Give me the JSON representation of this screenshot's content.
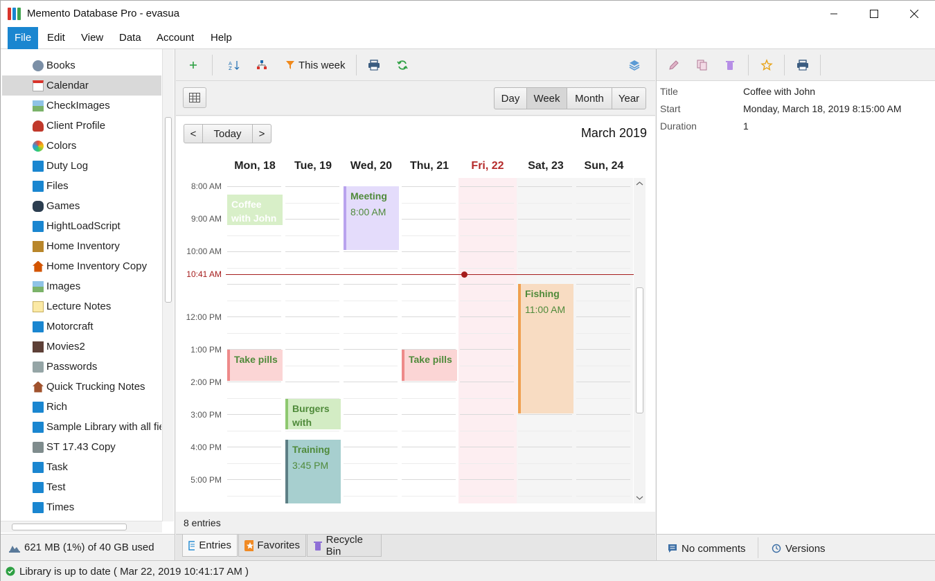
{
  "window": {
    "title": "Memento Database Pro - evasua"
  },
  "menu": [
    "File",
    "Edit",
    "View",
    "Data",
    "Account",
    "Help"
  ],
  "libraries": [
    {
      "label": "Books",
      "icon": "globe-icon"
    },
    {
      "label": "Calendar",
      "icon": "calendar-icon",
      "selected": true
    },
    {
      "label": "CheckImages",
      "icon": "image-icon"
    },
    {
      "label": "Client Profile",
      "icon": "person-icon"
    },
    {
      "label": "Colors",
      "icon": "palette-icon"
    },
    {
      "label": "Duty Log",
      "icon": "library-icon"
    },
    {
      "label": "Files",
      "icon": "library-icon"
    },
    {
      "label": "Games",
      "icon": "gamepad-icon"
    },
    {
      "label": "HightLoadScript",
      "icon": "library-icon"
    },
    {
      "label": "Home Inventory",
      "icon": "box-icon"
    },
    {
      "label": "Home Inventory Copy",
      "icon": "house-icon"
    },
    {
      "label": "Images",
      "icon": "image-icon"
    },
    {
      "label": "Lecture Notes",
      "icon": "note-icon"
    },
    {
      "label": "Motorcraft",
      "icon": "library-icon"
    },
    {
      "label": "Movies2",
      "icon": "film-icon"
    },
    {
      "label": "Passwords",
      "icon": "safe-icon"
    },
    {
      "label": "Quick Trucking Notes",
      "icon": "home-icon"
    },
    {
      "label": "Rich",
      "icon": "library-icon"
    },
    {
      "label": "Sample Library with all fie",
      "icon": "library-icon"
    },
    {
      "label": "ST 17.43 Copy",
      "icon": "calculator-icon"
    },
    {
      "label": "Task",
      "icon": "library-icon"
    },
    {
      "label": "Test",
      "icon": "library-icon"
    },
    {
      "label": "Times",
      "icon": "library-icon"
    }
  ],
  "storage": {
    "text": "621 MB (1%) of 40 GB used"
  },
  "toolbar": {
    "filter_label": "This week"
  },
  "views": [
    "Day",
    "Week",
    "Month",
    "Year"
  ],
  "active_view": "Week",
  "nav": {
    "prev": "<",
    "today": "Today",
    "next": ">"
  },
  "calendar": {
    "month_label": "March 2019",
    "days": [
      "Mon, 18",
      "Tue, 19",
      "Wed, 20",
      "Thu, 21",
      "Fri, 22",
      "Sat, 23",
      "Sun, 24"
    ],
    "today_index": 4,
    "time_labels": [
      "8:00 AM",
      "9:00 AM",
      "10:00 AM",
      "12:00 PM",
      "1:00 PM",
      "2:00 PM",
      "3:00 PM",
      "4:00 PM",
      "5:00 PM"
    ],
    "now_label": "10:41 AM",
    "events": [
      {
        "title": "Coffee with John",
        "time": ""
      },
      {
        "title": "Meeting",
        "time": "8:00 AM"
      },
      {
        "title": "Fishing",
        "time": "11:00 AM"
      },
      {
        "title": "Take pills",
        "time": ""
      },
      {
        "title": "Take pills",
        "time": ""
      },
      {
        "title": "Burgers with Lana",
        "time": ""
      },
      {
        "title": "Training",
        "time": "3:45 PM"
      }
    ],
    "entries_count": "8 entries"
  },
  "bottom_tabs": [
    "Entries",
    "Favorites",
    "Recycle Bin"
  ],
  "detail": {
    "fields": [
      {
        "label": "Title",
        "value": "Coffee with John"
      },
      {
        "label": "Start",
        "value": "Monday, March 18, 2019 8:15:00 AM"
      },
      {
        "label": "Duration",
        "value": "1"
      }
    ],
    "comments_label": "No comments",
    "versions_label": "Versions"
  },
  "status": {
    "text": "Library is up to date ( Mar 22, 2019 10:41:17 AM )"
  }
}
